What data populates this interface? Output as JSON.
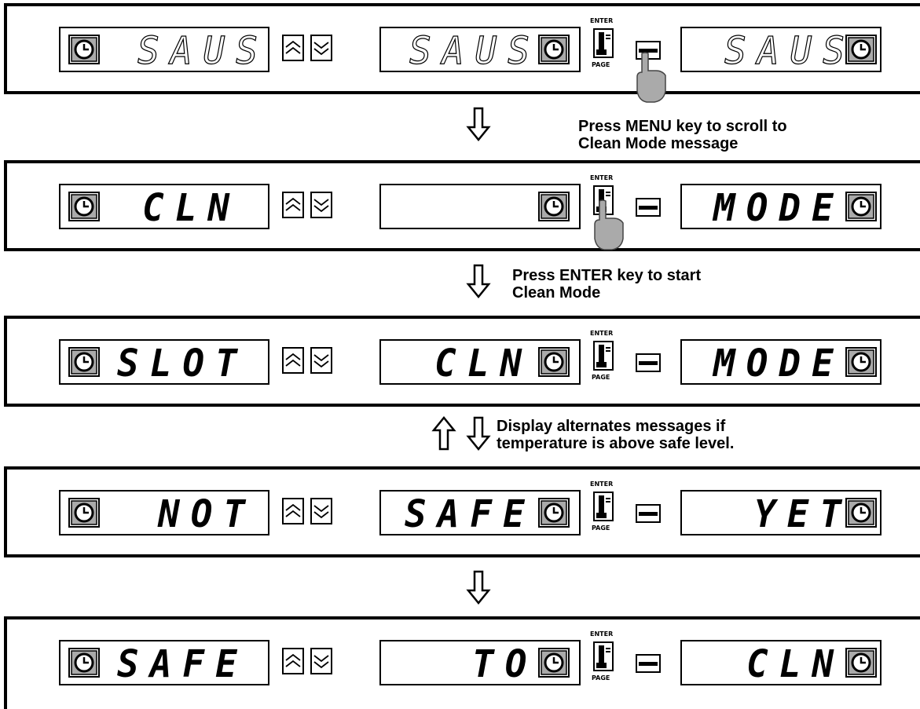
{
  "panels": [
    {
      "left_text": "SAUS",
      "mid_text": "SAUS",
      "right_text": "SAUS",
      "hand": "menu"
    },
    {
      "left_text": "CLN",
      "mid_text": "",
      "right_text": "MODE",
      "hand": "enter"
    },
    {
      "left_text": "SLOT",
      "mid_text": "CLN",
      "right_text": "MODE",
      "hand": ""
    },
    {
      "left_text": "NOT",
      "mid_text": "SAFE",
      "right_text": "YET",
      "hand": ""
    },
    {
      "left_text": "SAFE",
      "mid_text": "TO",
      "right_text": "CLN",
      "hand": ""
    }
  ],
  "labels": {
    "enter": "ENTER",
    "page": "PAGE"
  },
  "notes": {
    "n1_line1": "Press MENU key to scroll to",
    "n1_line2": "Clean Mode message",
    "n2_line1": "Press ENTER key to start",
    "n2_line2": "Clean Mode",
    "n3_line1": "Display alternates messages if",
    "n3_line2": "temperature is above safe level."
  },
  "icons": {
    "clock": "clock-icon",
    "up": "double-chevron-up-icon",
    "down": "double-chevron-down-icon",
    "thermometer": "thermometer-icon",
    "hand": "pointing-hand-icon"
  }
}
